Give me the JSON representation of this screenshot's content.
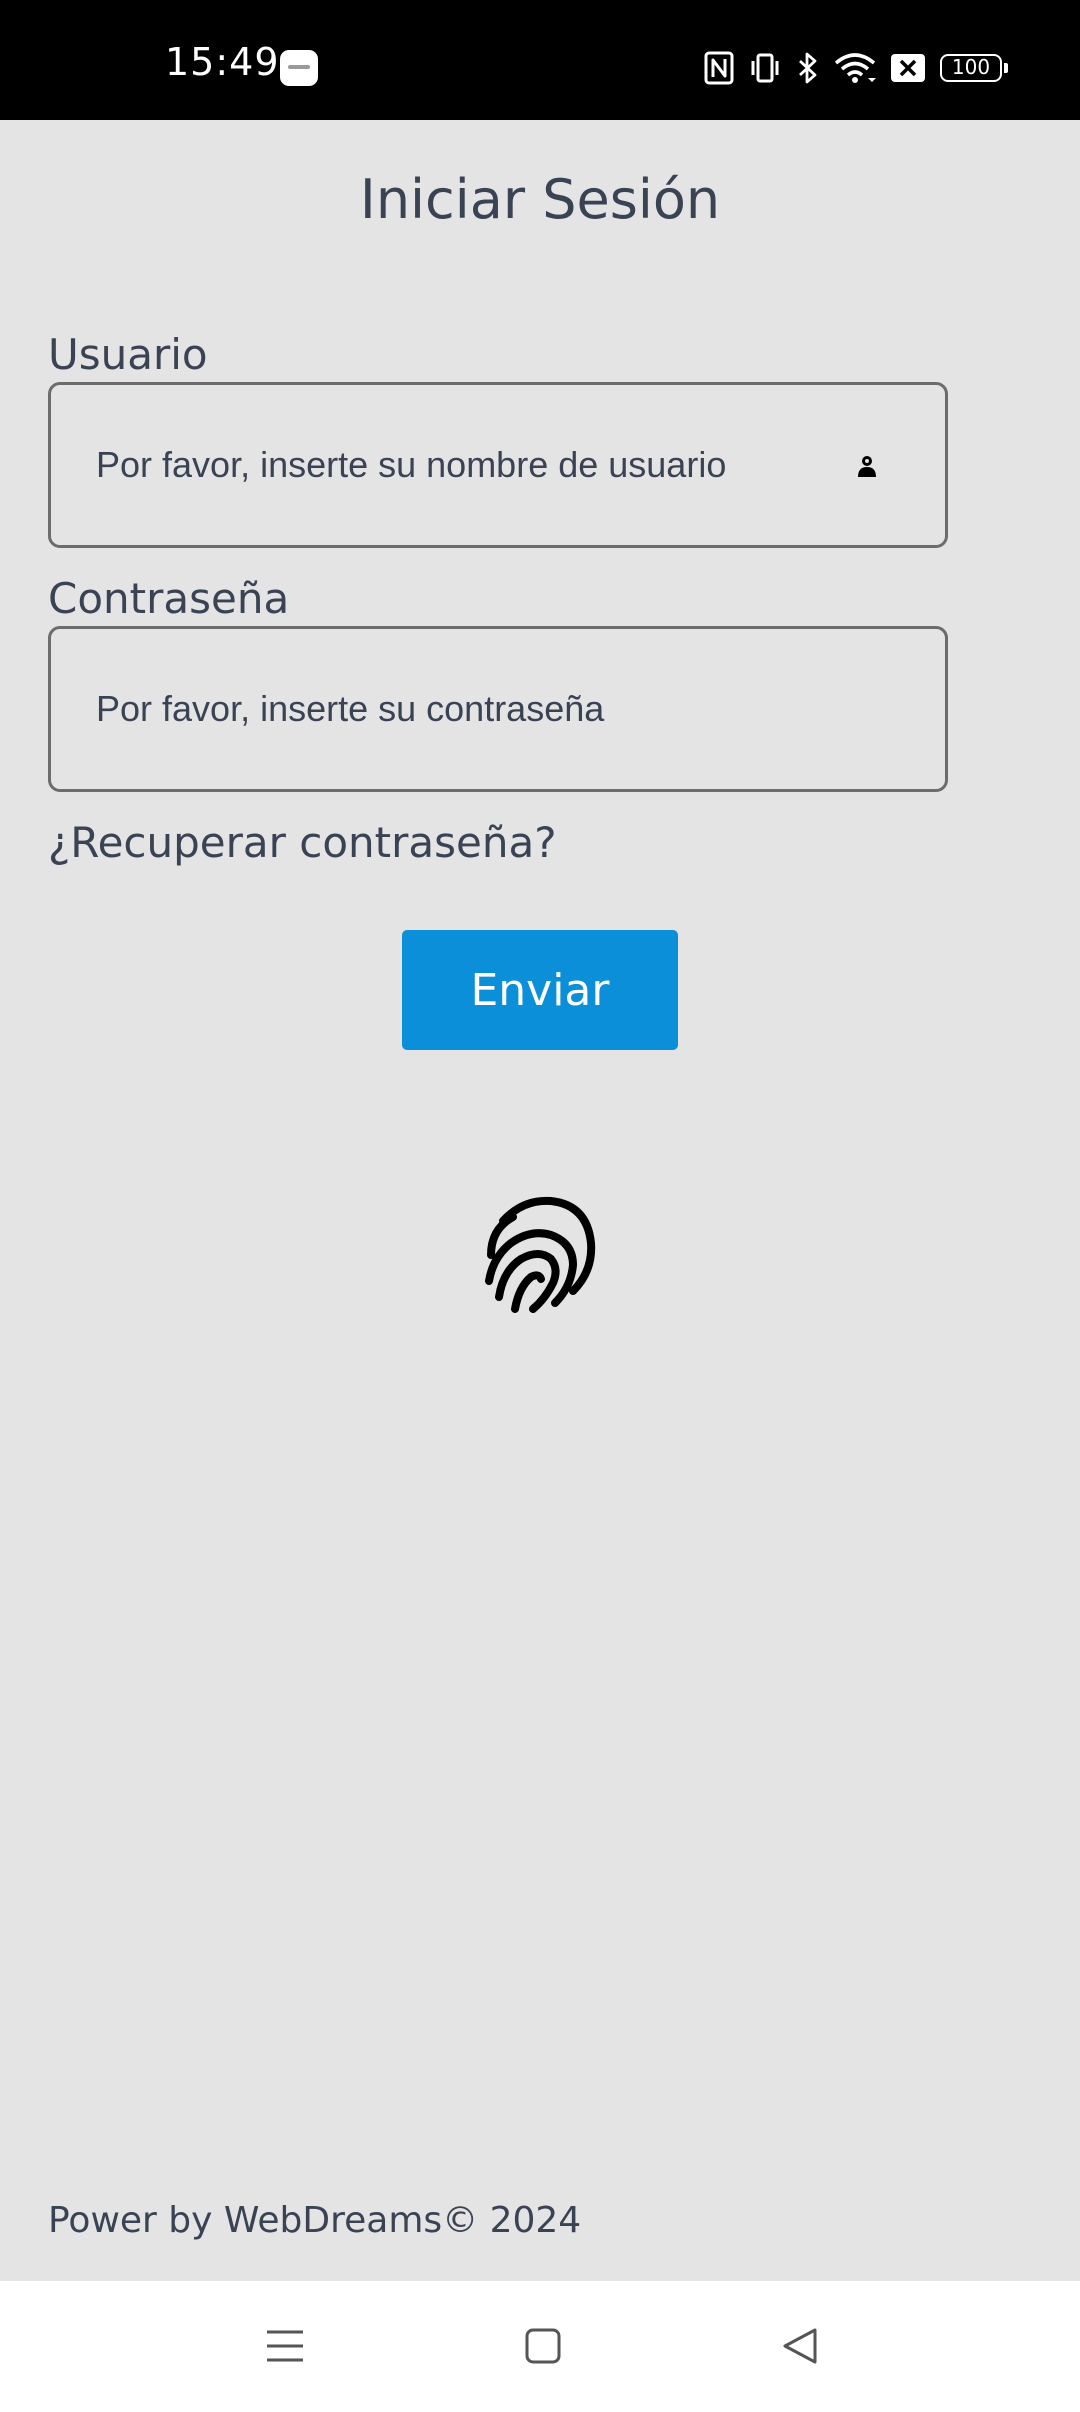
{
  "status_bar": {
    "time": "15:49",
    "battery": "100",
    "icons": [
      "nfc-icon",
      "vibrate-icon",
      "bluetooth-icon",
      "wifi-icon",
      "sim-icon",
      "battery-icon"
    ]
  },
  "login": {
    "title": "Iniciar Sesión",
    "username_label": "Usuario",
    "username_placeholder": "Por favor, inserte su nombre de usuario",
    "password_label": "Contraseña",
    "password_placeholder": "Por favor, inserte su contraseña",
    "recover_link": "¿Recuperar contraseña?",
    "submit_label": "Enviar",
    "fingerprint_icon": "fingerprint-icon"
  },
  "footer": {
    "text": "Power by WebDreams© 2024"
  },
  "nav_bar": {
    "buttons": [
      "menu-icon",
      "home-icon",
      "back-icon"
    ]
  },
  "colors": {
    "background": "#e4e4e5",
    "text": "#3a4354",
    "accent": "#0b8fd9",
    "status_bar": "#000000"
  }
}
